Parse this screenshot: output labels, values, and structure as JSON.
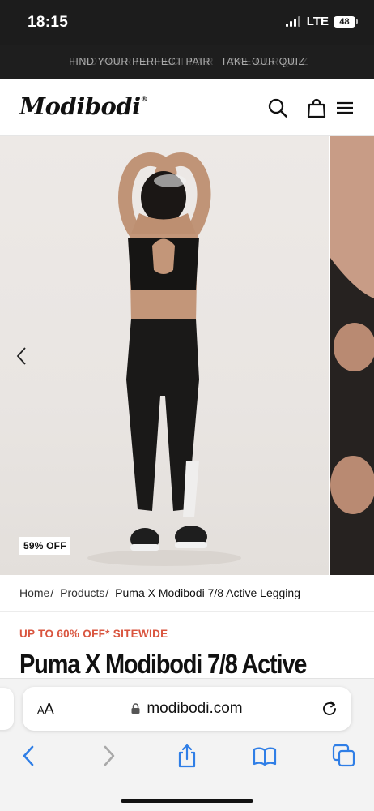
{
  "status_bar": {
    "time": "18:15",
    "network": "LTE",
    "battery": "48"
  },
  "announcement": {
    "text": "FIND YOUR PERFECT PAIR - TAKE OUR QUIZ"
  },
  "header": {
    "logo": "Modibodi",
    "logo_mark": "®",
    "icons": [
      "search-icon",
      "bag-icon",
      "menu-icon"
    ]
  },
  "gallery": {
    "badge": "59% OFF",
    "nav_icon": "chevron-left-icon"
  },
  "breadcrumb": {
    "items": [
      {
        "label": "Home",
        "sep": "/"
      },
      {
        "label": "Products",
        "sep": "/"
      },
      {
        "label": "Puma X Modibodi 7/8 Active Legging"
      }
    ]
  },
  "product": {
    "promo": "UP TO 60% OFF* SITEWIDE",
    "title": "Puma X Modibodi 7/8 Active"
  },
  "browser": {
    "aa_small": "A",
    "aa_large": "A",
    "url": "modibodi.com",
    "toolbar_icons": [
      "back-icon",
      "forward-icon",
      "share-icon",
      "bookmarks-icon",
      "tabs-icon"
    ]
  },
  "colors": {
    "promo": "#d9553f",
    "browser_accent": "#2f7ee6",
    "announcement_bg": "#1e1e1e"
  }
}
